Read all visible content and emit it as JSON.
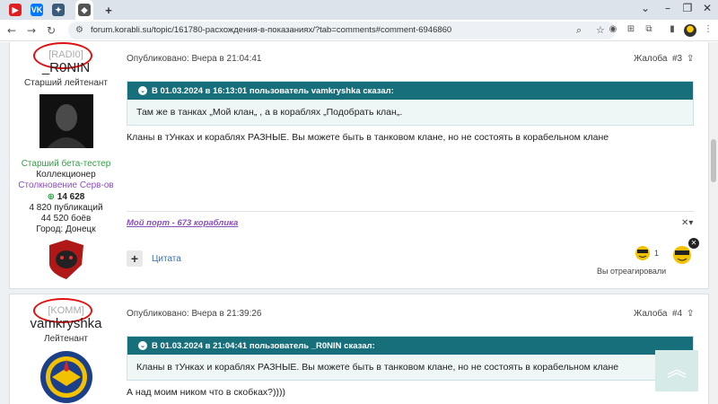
{
  "browser": {
    "url": "forum.korabli.su/topic/161780-расхождения-в-показаниях/?tab=comments#comment-6946860",
    "tab_badge_vk": "VK"
  },
  "posts": [
    {
      "rank_tag": "[RADI0]",
      "username": "_R0NIN",
      "title": "Старший лейтенант",
      "group1": "Старший бета-тестер",
      "group2": "Коллекционер",
      "group3": "Столкновение Серв-ов",
      "reputation": "14 628",
      "posts_count": "4 820 публикаций",
      "battles": "44 520 боёв",
      "city": "Город: Донецк",
      "meta": "Опубликовано: Вчера в 21:04:41",
      "report": "Жалоба",
      "number": "#3",
      "quote_header": "В 01.03.2024 в 16:13:01 пользователь vamkryshka сказал:",
      "quote_text": "Там же в танках „Мой клан„ , а в кораблях „Подобрать клан„.",
      "text": "Кланы в тУнках и кораблях РАЗНЫЕ.  Вы можете быть в танковом клане, но не  состоять в корабельном клане",
      "signature": "Мой порт - 673 кораблика",
      "cite_label": "Цитата",
      "reaction_count": "1",
      "reacted_label": "Вы отреагировали"
    },
    {
      "rank_tag": "[KOMM]",
      "username": "vamkryshka",
      "title": "Лейтенант",
      "meta": "Опубликовано: Вчера в 21:39:26",
      "report": "Жалоба",
      "number": "#4",
      "quote_header": "В 01.03.2024 в 21:04:41 пользователь _R0NIN сказал:",
      "quote_text": "Кланы в тУнках и кораблях РАЗНЫЕ.  Вы можете быть в танковом клане, но не  состоять в корабельном клане",
      "text": "А над моим ником что в скобках?))))"
    }
  ],
  "colors": {
    "quote_header": "#176f7b",
    "group_green": "#2f9e44",
    "group_violet": "#8a4fbf",
    "annotation": "#e01010"
  }
}
